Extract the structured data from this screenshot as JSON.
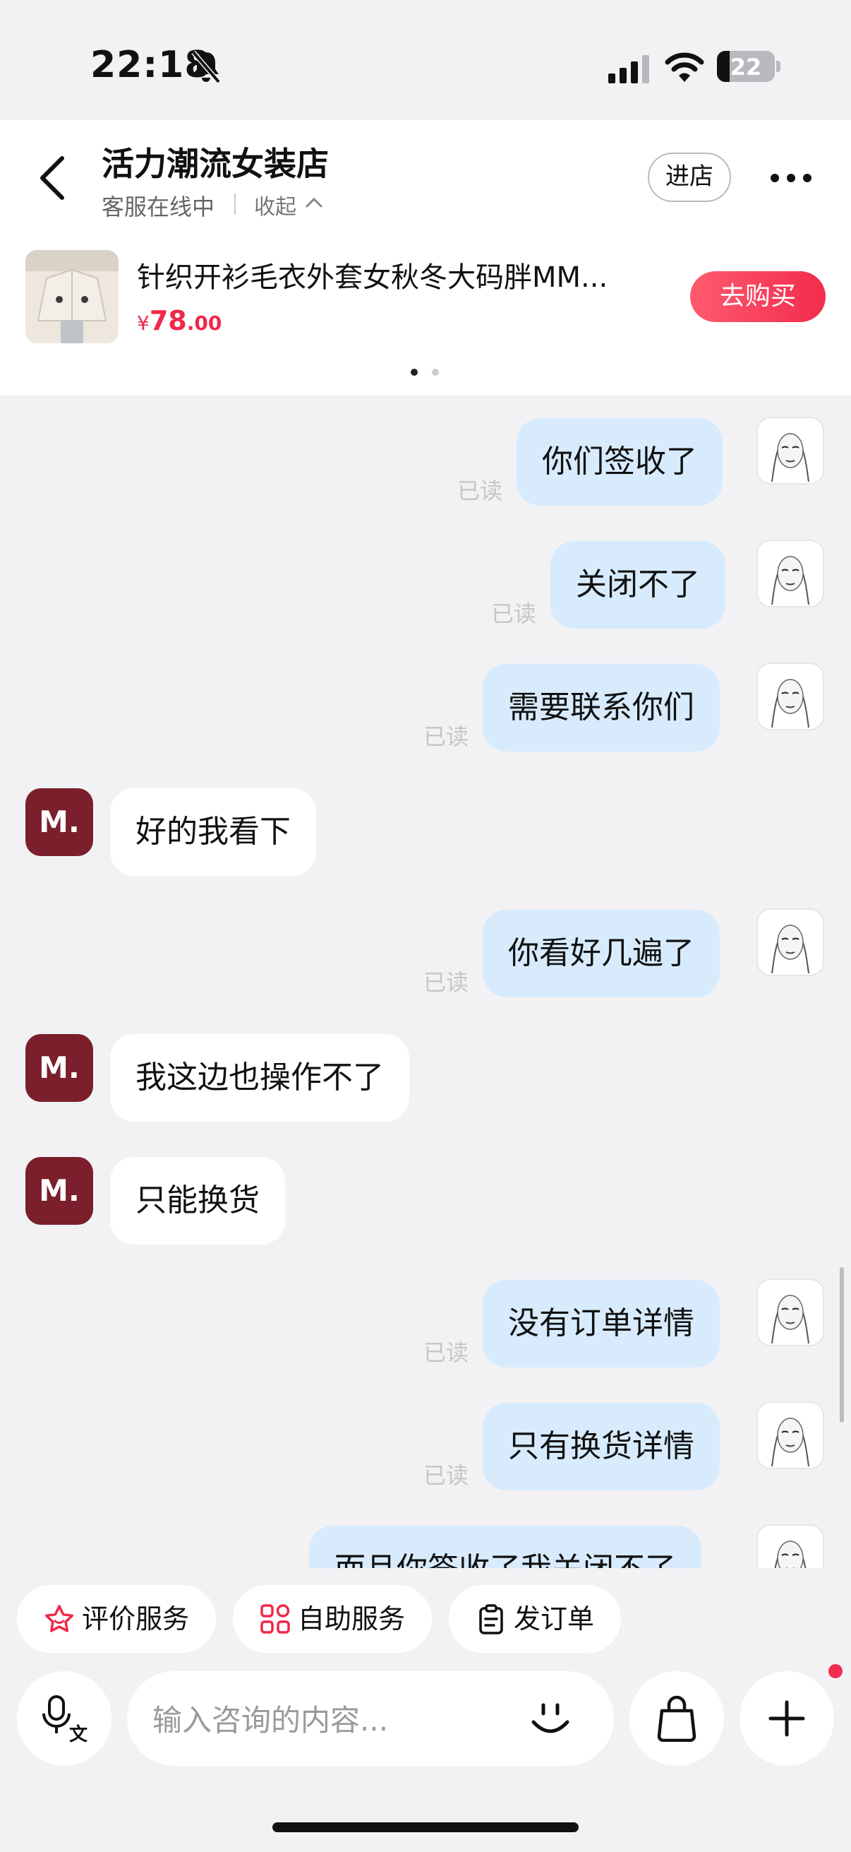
{
  "status_bar": {
    "time": "22:18",
    "battery": "22",
    "battery_level": 0.22
  },
  "header": {
    "shop_name": "活力潮流女装店",
    "online_status": "客服在线中",
    "collapse_label": "收起",
    "enter_store_label": "进店"
  },
  "product": {
    "title": "针织开衫毛衣外套女秋冬大码胖MM...",
    "price_currency": "¥",
    "price_int": "78",
    "price_dec": ".00",
    "buy_label": "去购买",
    "carousel_pages": 2,
    "carousel_active": 1
  },
  "messages": [
    {
      "from": "me",
      "text": "你们签收了",
      "status": "已读"
    },
    {
      "from": "me",
      "text": "关闭不了",
      "status": "已读"
    },
    {
      "from": "me",
      "text": "需要联系你们",
      "status": "已读"
    },
    {
      "from": "them",
      "text": "好的我看下",
      "avatar": "M."
    },
    {
      "from": "me",
      "text": "你看好几遍了",
      "status": "已读"
    },
    {
      "from": "them",
      "text": "我这边也操作不了",
      "avatar": "M."
    },
    {
      "from": "them",
      "text": "只能换货",
      "avatar": "M."
    },
    {
      "from": "me",
      "text": "没有订单详情",
      "status": "已读"
    },
    {
      "from": "me",
      "text": "只有换货详情",
      "status": "已读"
    },
    {
      "from": "me",
      "text": "而且你签收了我关闭不了",
      "status": ""
    }
  ],
  "quick_actions": [
    {
      "label": "评价服务",
      "icon": "star-icon"
    },
    {
      "label": "自助服务",
      "icon": "grid-icon"
    },
    {
      "label": "发订单",
      "icon": "clipboard-icon"
    }
  ],
  "input": {
    "placeholder": "输入咨询的内容..."
  },
  "colors": {
    "accent_red": "#f22c4e",
    "my_bubble": "#d7ebfd",
    "their_avatar": "#7a1f2b"
  }
}
